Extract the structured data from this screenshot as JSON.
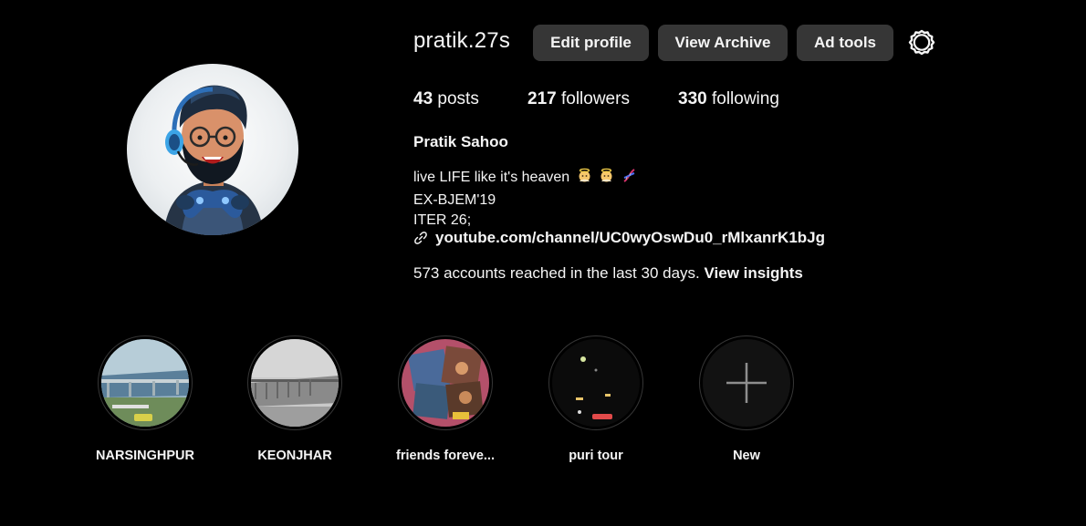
{
  "profile": {
    "username": "pratik.27s",
    "full_name": "Pratik Sahoo",
    "avatar_icon": "cartoon-gamer-avatar"
  },
  "actions": {
    "edit_profile": "Edit profile",
    "view_archive": "View Archive",
    "ad_tools": "Ad tools",
    "settings_icon": "gear-icon"
  },
  "stats": {
    "posts_count": "43",
    "posts_label": "posts",
    "followers_count": "217",
    "followers_label": "followers",
    "following_count": "330",
    "following_label": "following"
  },
  "bio": {
    "line1": "live LIFE like it's heaven",
    "line1_emojis": [
      "baby-angel-emoji",
      "baby-angel-emoji",
      "dna-emoji"
    ],
    "line2": "EX-BJEM'19",
    "line3": "ITER 26;",
    "link_icon": "link-icon",
    "link_text": "youtube.com/channel/UC0wyOswDu0_rMlxanrK1bJg"
  },
  "insights": {
    "text": "573 accounts reached in the last 30 days.",
    "link": "View insights"
  },
  "highlights": [
    {
      "label": "NARSINGHPUR"
    },
    {
      "label": "KEONJHAR"
    },
    {
      "label": "friends foreve..."
    },
    {
      "label": "puri tour"
    },
    {
      "label": "New",
      "icon": "plus-icon"
    }
  ],
  "colors": {
    "background": "#000000",
    "button_bg": "#363636",
    "text": "#f5f5f5",
    "ring": "#363636"
  }
}
